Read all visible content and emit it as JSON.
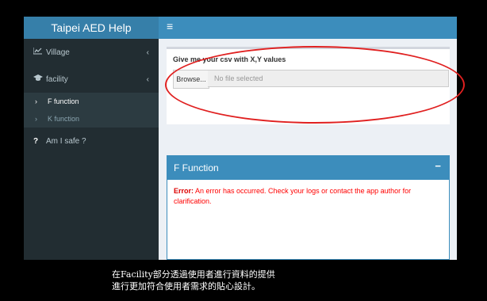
{
  "app": {
    "title": "Taipei AED Help",
    "menu_icon": "≡"
  },
  "sidebar": {
    "items": [
      {
        "label": "Village",
        "icon": "line-chart-icon"
      },
      {
        "label": "facility",
        "icon": "graduation-cap-icon"
      },
      {
        "label": "Am I safe ?",
        "icon": "question-icon"
      }
    ],
    "subitems": [
      {
        "label": "F function",
        "active": true
      },
      {
        "label": "K function",
        "active": false
      }
    ]
  },
  "upload": {
    "label": "Give me your csv with X,Y values",
    "browse_label": "Browse...",
    "placeholder": "No file selected"
  },
  "panel": {
    "title": "F Function",
    "collapse": "−",
    "error_prefix": "Error:",
    "error_text": " An error has occurred. Check your logs or contact the app author for clarification."
  },
  "caption": {
    "line1": "在Facility部分透過使用者進行資料的提供",
    "line2": "進行更加符合使用者需求的貼心設計。"
  },
  "colors": {
    "header": "#3c8dbc",
    "logo": "#367fa9",
    "sidebar": "#222d32",
    "highlight": "#e02020"
  }
}
